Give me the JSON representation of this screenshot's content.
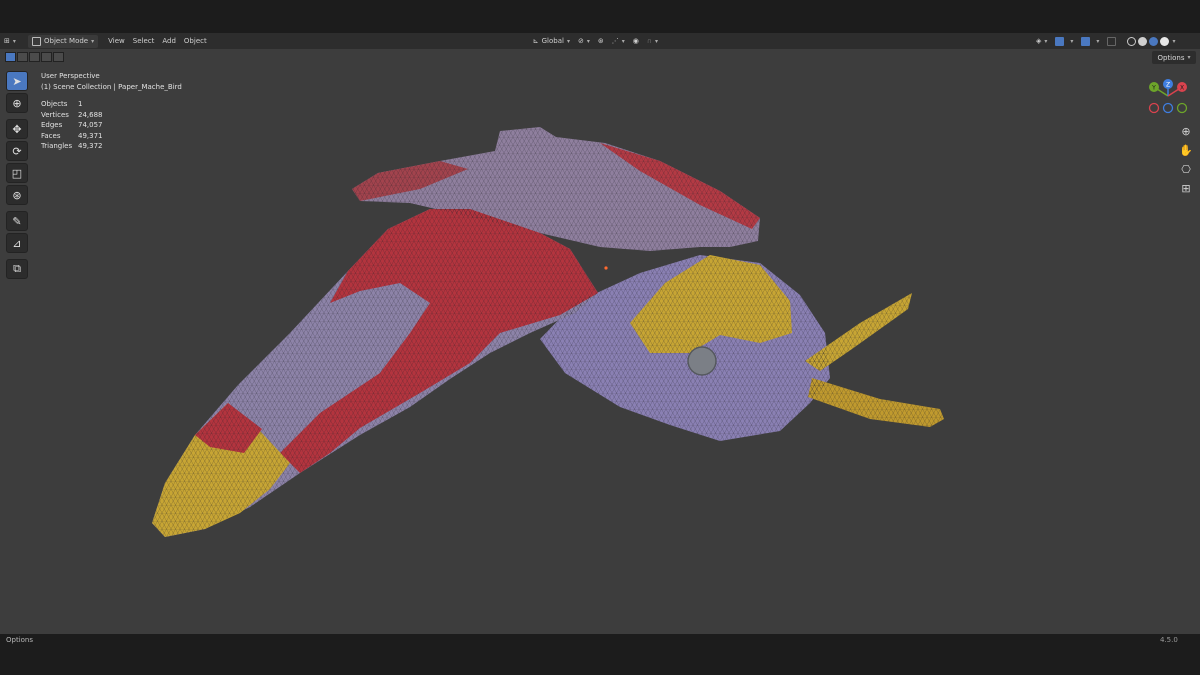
{
  "header": {
    "mode_label": "Object Mode",
    "menus": [
      "View",
      "Select",
      "Add",
      "Object"
    ],
    "transform_orientation": "Global"
  },
  "overlay": {
    "view_name": "User Perspective",
    "collection_path": "(1) Scene Collection | Paper_Mache_Bird"
  },
  "stats": [
    {
      "label": "Objects",
      "value": "1"
    },
    {
      "label": "Vertices",
      "value": "24,688"
    },
    {
      "label": "Edges",
      "value": "74,057"
    },
    {
      "label": "Faces",
      "value": "49,371"
    },
    {
      "label": "Triangles",
      "value": "49,372"
    }
  ],
  "options_label": "Options",
  "gizmo": {
    "y": "Y",
    "z": "Z",
    "x": "X"
  },
  "status": {
    "left": "Options",
    "version": "4.5.0"
  },
  "colors": {
    "accent": "#4a78c0",
    "x_axis": "#d9434e",
    "y_axis": "#6da52a",
    "z_axis": "#3f7ee0",
    "viewport_bg": "#3d3d3d",
    "model_purple": "#8b82a9",
    "model_red": "#b0363f",
    "model_yellow": "#c8a52e"
  }
}
